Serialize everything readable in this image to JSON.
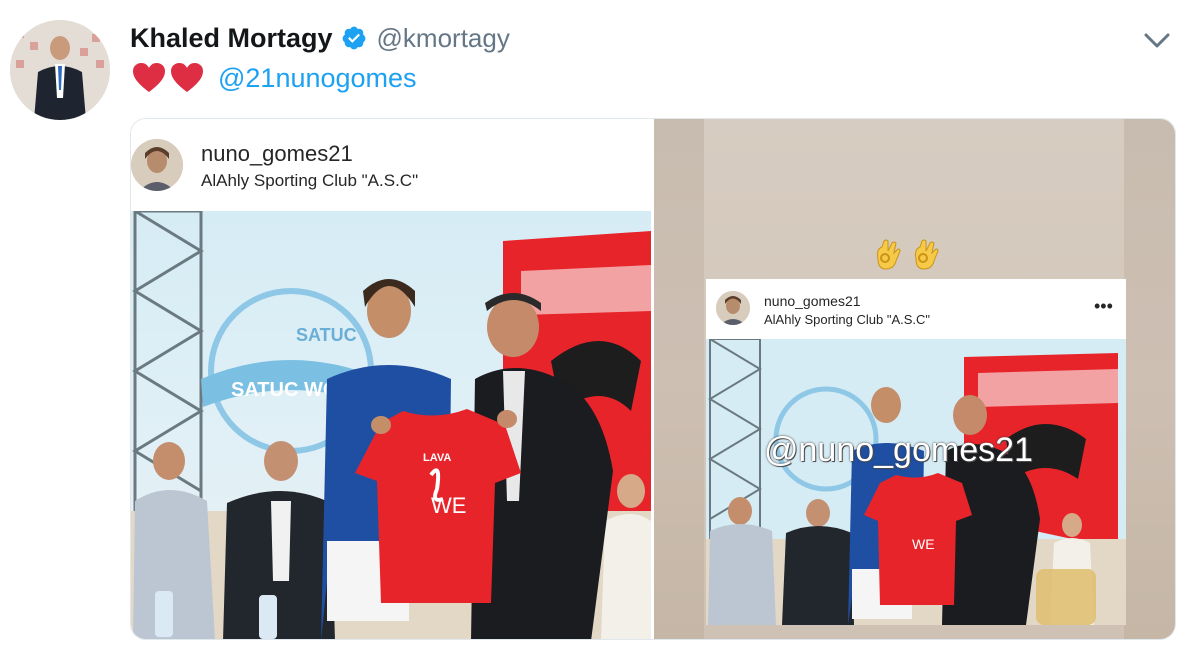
{
  "tweet": {
    "author_name": "Khaled Mortagy",
    "author_handle": "@kmortagy",
    "verified": true,
    "hearts": [
      "red-heart",
      "red-heart"
    ],
    "mention": "@21nunogomes",
    "menu_icon": "chevron-down-icon"
  },
  "media": {
    "left": {
      "instagram_user": "nuno_gomes21",
      "instagram_location": "AlAhly Sporting Club \"A.S.C\""
    },
    "right": {
      "emojis": [
        "ok-hand",
        "ok-hand"
      ],
      "instagram_user": "nuno_gomes21",
      "instagram_location": "AlAhly Sporting Club \"A.S.C\"",
      "more_icon": "more-dots-icon",
      "story_tag": "@nuno_gomes21"
    }
  },
  "colors": {
    "link": "#1da1f2",
    "verified": "#1da1f2",
    "handle_gray": "#657786",
    "heart": "#e0245e",
    "jersey_red": "#e8242b",
    "stage_blue": "#cfe6f2"
  }
}
